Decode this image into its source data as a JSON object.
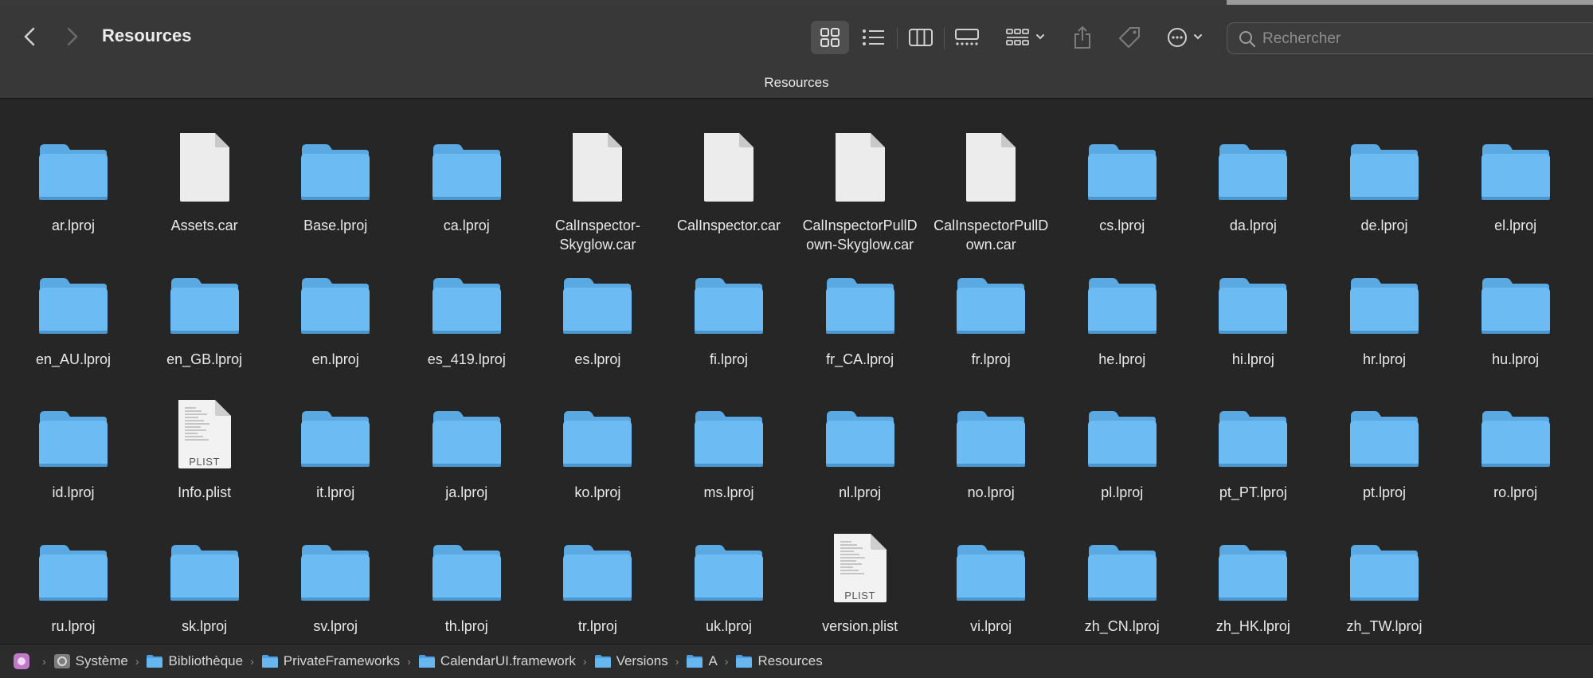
{
  "window": {
    "title": "Resources",
    "path_title": "Resources"
  },
  "toolbar": {
    "back_icon": "chevron-left-icon",
    "forward_icon": "chevron-right-icon",
    "search_placeholder": "Rechercher",
    "search_value": ""
  },
  "colors": {
    "folder": "#6cbcf3",
    "folder_tab": "#5aa9e3",
    "background": "#262626",
    "toolbar": "#383838"
  },
  "items": [
    {
      "name": "ar.lproj",
      "kind": "folder"
    },
    {
      "name": "Assets.car",
      "kind": "file"
    },
    {
      "name": "Base.lproj",
      "kind": "folder"
    },
    {
      "name": "ca.lproj",
      "kind": "folder"
    },
    {
      "name": "CalInspector-\nSkyglow.car",
      "kind": "file"
    },
    {
      "name": "CalInspector.car",
      "kind": "file"
    },
    {
      "name": "CalInspectorPullD\nown-Skyglow.car",
      "kind": "file"
    },
    {
      "name": "CalInspectorPullD\nown.car",
      "kind": "file"
    },
    {
      "name": "cs.lproj",
      "kind": "folder"
    },
    {
      "name": "da.lproj",
      "kind": "folder"
    },
    {
      "name": "de.lproj",
      "kind": "folder"
    },
    {
      "name": "el.lproj",
      "kind": "folder"
    },
    {
      "name": "en_AU.lproj",
      "kind": "folder"
    },
    {
      "name": "en_GB.lproj",
      "kind": "folder"
    },
    {
      "name": "en.lproj",
      "kind": "folder"
    },
    {
      "name": "es_419.lproj",
      "kind": "folder"
    },
    {
      "name": "es.lproj",
      "kind": "folder"
    },
    {
      "name": "fi.lproj",
      "kind": "folder"
    },
    {
      "name": "fr_CA.lproj",
      "kind": "folder"
    },
    {
      "name": "fr.lproj",
      "kind": "folder"
    },
    {
      "name": "he.lproj",
      "kind": "folder"
    },
    {
      "name": "hi.lproj",
      "kind": "folder"
    },
    {
      "name": "hr.lproj",
      "kind": "folder"
    },
    {
      "name": "hu.lproj",
      "kind": "folder"
    },
    {
      "name": "id.lproj",
      "kind": "folder"
    },
    {
      "name": "Info.plist",
      "kind": "plist",
      "badge": "PLIST"
    },
    {
      "name": "it.lproj",
      "kind": "folder"
    },
    {
      "name": "ja.lproj",
      "kind": "folder"
    },
    {
      "name": "ko.lproj",
      "kind": "folder"
    },
    {
      "name": "ms.lproj",
      "kind": "folder"
    },
    {
      "name": "nl.lproj",
      "kind": "folder"
    },
    {
      "name": "no.lproj",
      "kind": "folder"
    },
    {
      "name": "pl.lproj",
      "kind": "folder"
    },
    {
      "name": "pt_PT.lproj",
      "kind": "folder"
    },
    {
      "name": "pt.lproj",
      "kind": "folder"
    },
    {
      "name": "ro.lproj",
      "kind": "folder"
    },
    {
      "name": "ru.lproj",
      "kind": "folder"
    },
    {
      "name": "sk.lproj",
      "kind": "folder"
    },
    {
      "name": "sv.lproj",
      "kind": "folder"
    },
    {
      "name": "th.lproj",
      "kind": "folder"
    },
    {
      "name": "tr.lproj",
      "kind": "folder"
    },
    {
      "name": "uk.lproj",
      "kind": "folder"
    },
    {
      "name": "version.plist",
      "kind": "plist",
      "badge": "PLIST"
    },
    {
      "name": "vi.lproj",
      "kind": "folder"
    },
    {
      "name": "zh_CN.lproj",
      "kind": "folder"
    },
    {
      "name": "zh_HK.lproj",
      "kind": "folder"
    },
    {
      "name": "zh_TW.lproj",
      "kind": "folder"
    }
  ],
  "path_bar": [
    {
      "label": "",
      "icon": "disk-icon"
    },
    {
      "label": "Système",
      "icon": "system-icon"
    },
    {
      "label": "Bibliothèque",
      "icon": "folder-icon"
    },
    {
      "label": "PrivateFrameworks",
      "icon": "folder-icon"
    },
    {
      "label": "CalendarUI.framework",
      "icon": "folder-icon"
    },
    {
      "label": "Versions",
      "icon": "folder-icon"
    },
    {
      "label": "A",
      "icon": "folder-icon"
    },
    {
      "label": "Resources",
      "icon": "folder-icon"
    }
  ]
}
